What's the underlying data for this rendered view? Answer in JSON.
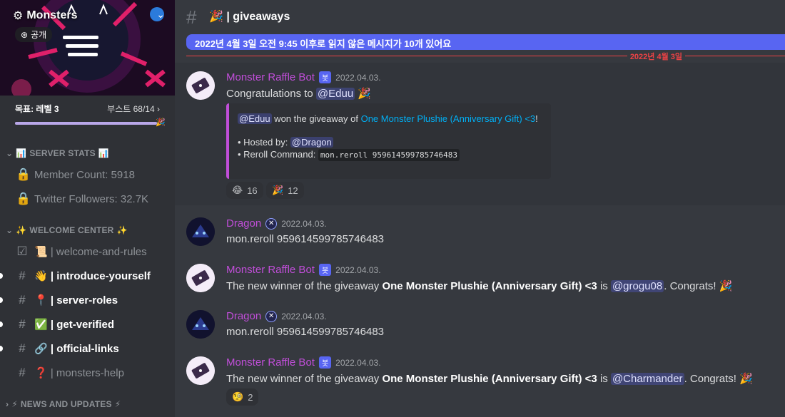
{
  "server": {
    "name": "Monsters",
    "public_label": "공개",
    "boost_goal": "목표: 레벨 3",
    "boost_count": "부스트 68/14",
    "boost_progress": 0.97
  },
  "categories": {
    "stats": "SERVER STATS",
    "welcome": "WELCOME CENTER",
    "news": "NEWS AND UPDATES"
  },
  "channels": [
    {
      "name": "Member Count: 5918",
      "icon": "lock-icon",
      "glyph": "🔒"
    },
    {
      "name": "Twitter Followers: 32.7K",
      "icon": "lock-icon",
      "glyph": "🔒"
    },
    {
      "name": "📜 | welcome-and-rules",
      "icon": "checkbox-icon",
      "glyph": "☑"
    },
    {
      "name": "👋 | introduce-yourself",
      "icon": "hash-icon",
      "glyph": "#"
    },
    {
      "name": "📍 | server-roles",
      "icon": "hash-icon",
      "glyph": "#"
    },
    {
      "name": "✅ | get-verified",
      "icon": "hash-icon",
      "glyph": "#"
    },
    {
      "name": "🔗 | official-links",
      "icon": "hash-icon",
      "glyph": "#"
    },
    {
      "name": "❓ | monsters-help",
      "icon": "hash-icon",
      "glyph": "#"
    }
  ],
  "header": {
    "channel_name": "🎉 | giveaways"
  },
  "new_messages_bar": "2022년 4월 3일 오전 9:45 이후로 읽지 않은 메시지가 10개 있어요",
  "date_divider": "2022년 4월 3일",
  "messages": [
    {
      "author": "Monster Raffle Bot",
      "tag": "봇",
      "time": "2022.04.03.",
      "pre": "Congratulations to ",
      "mention": "@Eduu",
      "post": " 🎉",
      "embed": {
        "mention": "@Eduu",
        "won_text": " won the giveaway of ",
        "link": "One Monster Plushie (Anniversary Gift) <3",
        "end": "!",
        "hosted_label": "• Hosted by: ",
        "host": "@Dragon",
        "reroll_label": "• Reroll Command: ",
        "reroll_cmd": "mon.reroll 959614599785746483"
      },
      "reactions": [
        {
          "emoji": "😂",
          "count": "16"
        },
        {
          "emoji": "🎉",
          "count": "12"
        }
      ]
    },
    {
      "author": "Dragon",
      "time": "2022.04.03.",
      "text": "mon.reroll 959614599785746483"
    },
    {
      "author": "Monster Raffle Bot",
      "tag": "봇",
      "time": "2022.04.03.",
      "pre": "The new winner of the giveaway ",
      "bold": "One Monster Plushie (Anniversary Gift) <3",
      "mid": " is ",
      "mention": "@grogu08",
      "post": ". Congrats! 🎉"
    },
    {
      "author": "Dragon",
      "time": "2022.04.03.",
      "text": "mon.reroll 959614599785746483"
    },
    {
      "author": "Monster Raffle Bot",
      "tag": "봇",
      "time": "2022.04.03.",
      "pre": "The new winner of the giveaway ",
      "bold": "One Monster Plushie (Anniversary Gift) <3",
      "mid": " is ",
      "mention": "@Charmander",
      "post": ". Congrats! 🎉",
      "reactions": [
        {
          "emoji": "🧐",
          "count": "2"
        }
      ]
    }
  ],
  "colors": {
    "accent": "#5865f2",
    "bot_name": "#c04ed8",
    "unread_red": "#ed4245",
    "link": "#00aff4"
  }
}
